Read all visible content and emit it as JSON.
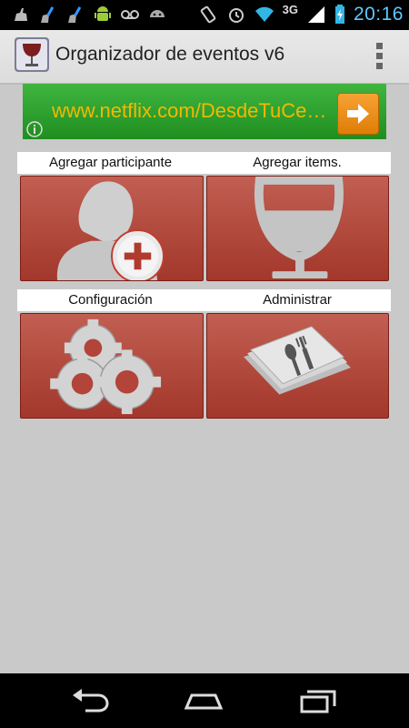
{
  "status_bar": {
    "time": "20:16",
    "network": "3G",
    "icons": [
      "cleaner-icon",
      "broom-icon",
      "broom-icon",
      "android-icon",
      "voicemail-icon",
      "gamepad-icon",
      "rotate-icon",
      "alarm-icon",
      "wifi-icon",
      "signal-icon",
      "battery-icon"
    ]
  },
  "action_bar": {
    "title": "Organizador de eventos v6",
    "app_icon": "wine-glass-icon",
    "overflow_icon": "overflow-menu-icon"
  },
  "ad_banner": {
    "text": "www.netflix.com/DesdeTuCe…",
    "arrow_icon": "arrow-right-icon",
    "info_icon": "info-icon"
  },
  "tiles": [
    {
      "label": "Agregar participante",
      "icon": "add-person-icon"
    },
    {
      "label": "Agregar items.",
      "icon": "wine-glass-icon"
    },
    {
      "label": "Configuración",
      "icon": "gears-icon"
    },
    {
      "label": "Administrar",
      "icon": "menu-folder-icon"
    }
  ],
  "nav_bar": {
    "buttons": [
      "back-icon",
      "home-icon",
      "recent-apps-icon"
    ]
  },
  "colors": {
    "tile": "#b24a3e",
    "background": "#c9c9c9",
    "ad_green": "#2a9f2b",
    "ad_text": "#f5b800",
    "clock": "#5fc8ff"
  }
}
